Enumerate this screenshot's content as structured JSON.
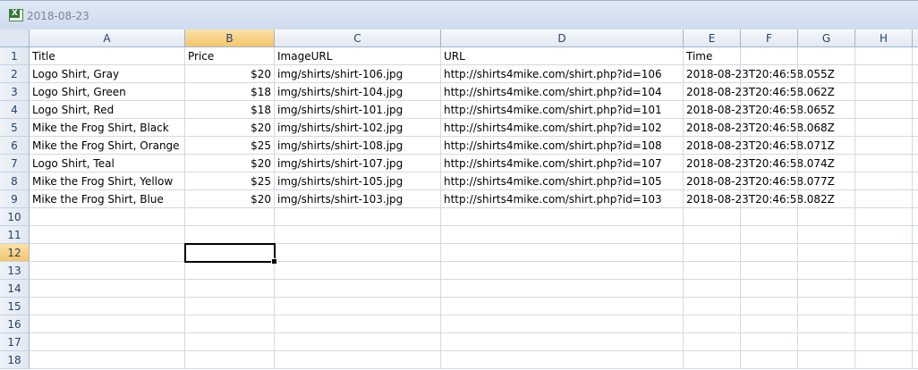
{
  "window": {
    "title": "2018-08-23",
    "icon": "excel-icon"
  },
  "columns": [
    "A",
    "B",
    "C",
    "D",
    "E",
    "F",
    "G",
    "H"
  ],
  "selected_cell": "B12",
  "rows": [
    [
      "Title",
      "Price",
      "ImageURL",
      "URL",
      "Time"
    ],
    [
      "Logo Shirt, Gray",
      "$20",
      "img/shirts/shirt-106.jpg",
      "http://shirts4mike.com/shirt.php?id=106",
      "2018-08-23T20:46:58.055Z"
    ],
    [
      "Logo Shirt, Green",
      "$18",
      "img/shirts/shirt-104.jpg",
      "http://shirts4mike.com/shirt.php?id=104",
      "2018-08-23T20:46:58.062Z"
    ],
    [
      "Logo Shirt, Red",
      "$18",
      "img/shirts/shirt-101.jpg",
      "http://shirts4mike.com/shirt.php?id=101",
      "2018-08-23T20:46:58.065Z"
    ],
    [
      "Mike the Frog Shirt, Black",
      "$20",
      "img/shirts/shirt-102.jpg",
      "http://shirts4mike.com/shirt.php?id=102",
      "2018-08-23T20:46:58.068Z"
    ],
    [
      "Mike the Frog Shirt, Orange",
      "$25",
      "img/shirts/shirt-108.jpg",
      "http://shirts4mike.com/shirt.php?id=108",
      "2018-08-23T20:46:58.071Z"
    ],
    [
      "Logo Shirt, Teal",
      "$20",
      "img/shirts/shirt-107.jpg",
      "http://shirts4mike.com/shirt.php?id=107",
      "2018-08-23T20:46:58.074Z"
    ],
    [
      "Mike the Frog Shirt, Yellow",
      "$25",
      "img/shirts/shirt-105.jpg",
      "http://shirts4mike.com/shirt.php?id=105",
      "2018-08-23T20:46:58.077Z"
    ],
    [
      "Mike the Frog Shirt, Blue",
      "$20",
      "img/shirts/shirt-103.jpg",
      "http://shirts4mike.com/shirt.php?id=103",
      "2018-08-23T20:46:58.082Z"
    ]
  ],
  "row_numbers": [
    "1",
    "2",
    "3",
    "4",
    "5",
    "6",
    "7",
    "8",
    "9",
    "10",
    "11",
    "12",
    "13",
    "14",
    "15",
    "16",
    "17",
    "18"
  ]
}
